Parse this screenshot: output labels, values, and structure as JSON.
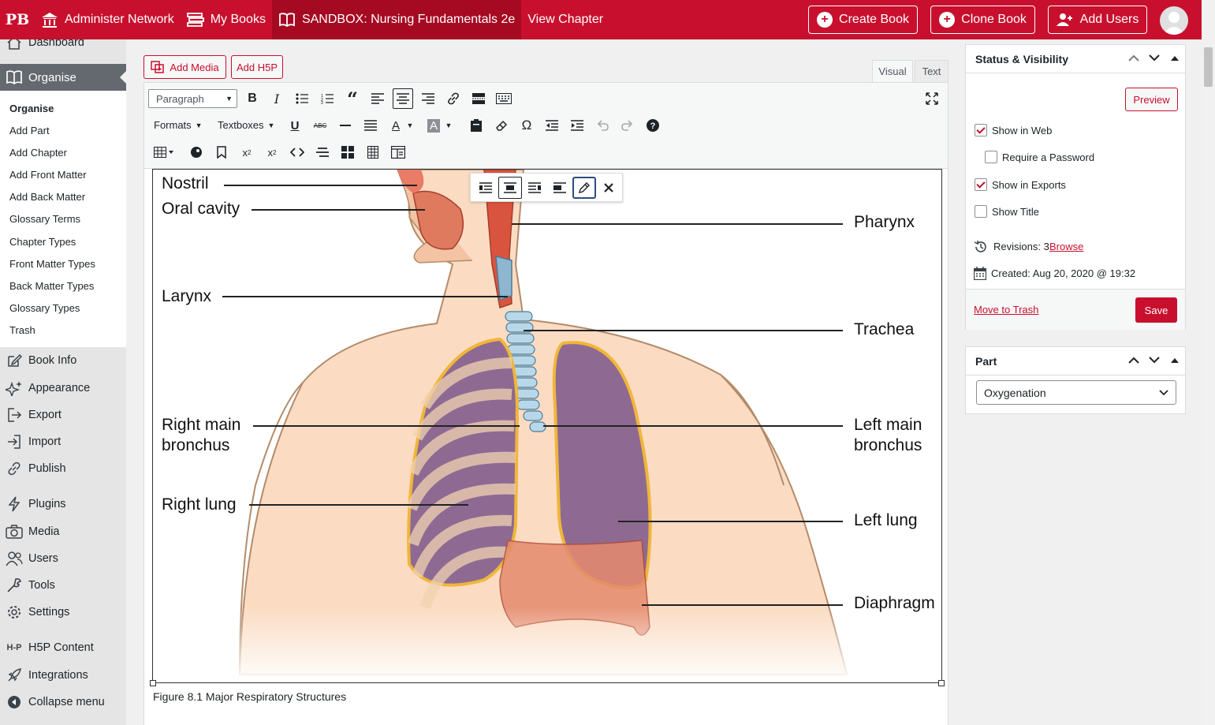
{
  "topbar": {
    "logo": "PB",
    "administer": "Administer Network",
    "my_books": "My Books",
    "book_title": "SANDBOX: Nursing Fundamentals 2e",
    "view_chapter": "View Chapter",
    "create_book": "Create Book",
    "clone_book": "Clone Book",
    "add_users": "Add Users"
  },
  "sidebar": {
    "dashboard": "Dashboard",
    "organise": "Organise",
    "submenu": [
      "Organise",
      "Add Part",
      "Add Chapter",
      "Add Front Matter",
      "Add Back Matter",
      "Glossary Terms",
      "Chapter Types",
      "Front Matter Types",
      "Back Matter Types",
      "Glossary Types",
      "Trash"
    ],
    "items": [
      "Book Info",
      "Appearance",
      "Export",
      "Import",
      "Publish",
      "Plugins",
      "Media",
      "Users",
      "Tools",
      "Settings",
      "H5P Content",
      "Integrations",
      "Collapse menu"
    ]
  },
  "editor": {
    "add_media": "Add Media",
    "add_h5p": "Add H5P",
    "tab_visual": "Visual",
    "tab_text": "Text",
    "paragraph": "Paragraph",
    "formats": "Formats",
    "textboxes": "Textboxes",
    "caption": "Figure 8.1 Major Respiratory Structures"
  },
  "figure_labels": {
    "nostril": "Nostril",
    "oral_cavity": "Oral cavity",
    "pharynx": "Pharynx",
    "larynx": "Larynx",
    "trachea": "Trachea",
    "right_main_bronchus_1": "Right main",
    "right_main_bronchus_2": "bronchus",
    "left_main_bronchus_1": "Left main",
    "left_main_bronchus_2": "bronchus",
    "right_lung": "Right lung",
    "left_lung": "Left lung",
    "diaphragm": "Diaphragm"
  },
  "status_panel": {
    "title": "Status & Visibility",
    "preview": "Preview",
    "show_in_web": "Show in Web",
    "show_in_web_checked": true,
    "require_password": "Require a Password",
    "require_password_checked": false,
    "show_in_exports": "Show in Exports",
    "show_in_exports_checked": true,
    "show_title": "Show Title",
    "show_title_checked": false,
    "revisions_label": "Revisions: 3",
    "browse": "Browse",
    "created": "Created: Aug 20, 2020 @ 19:32",
    "move_to_trash": "Move to Trash",
    "save": "Save"
  },
  "part_panel": {
    "title": "Part",
    "selected": "Oxygenation"
  },
  "colors": {
    "brand": "#c8102e",
    "lung": "#8e6a93",
    "skin": "#fbdcc3"
  }
}
